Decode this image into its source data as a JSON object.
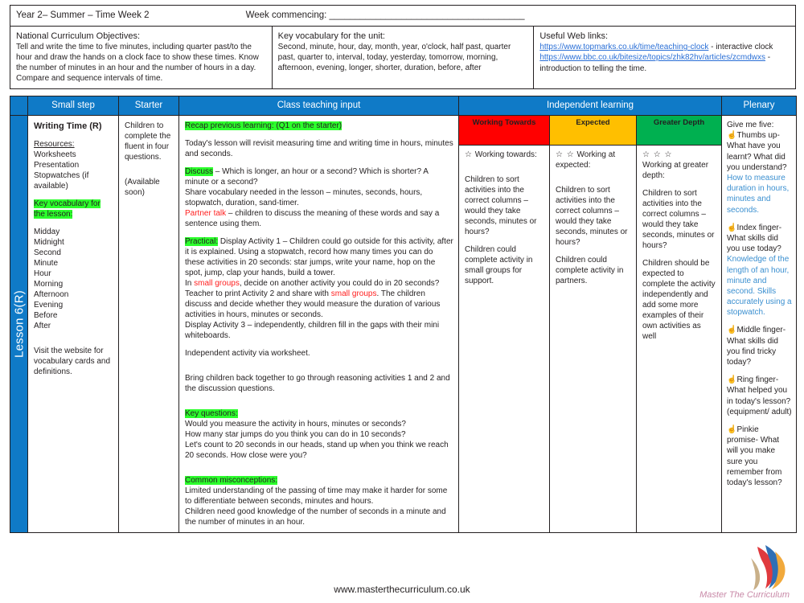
{
  "header": {
    "doc_title": "Year 2– Summer – Time Week 2",
    "week_commencing": "Week commencing: ______________________________________"
  },
  "info": {
    "nc_heading": "National Curriculum Objectives:",
    "nc_body": "Tell and write the time to five minutes, including quarter past/to the hour and draw the hands on a clock face to show these times. Know the number of minutes in an hour and the number of hours in a day. Compare and sequence intervals of time.",
    "vocab_heading": "Key vocabulary for the unit:",
    "vocab_body": "Second, minute, hour, day, month, year, o'clock, half past, quarter past, quarter to, interval, today, yesterday, tomorrow, morning, afternoon, evening, longer, shorter, duration, before, after",
    "weblinks_heading": "Useful Web links:",
    "weblinks": [
      {
        "url": "https://www.topmarks.co.uk/time/teaching-clock",
        "desc": " - interactive clock"
      },
      {
        "url": "https://www.bbc.co.uk/bitesize/topics/zhk82hv/articles/zcmdwxs",
        "desc": " - introduction to telling the time."
      }
    ]
  },
  "columns": {
    "small_step": "Small step",
    "starter": "Starter",
    "class_teaching_input": "Class teaching input",
    "independent_learning": "Independent learning",
    "plenary": "Plenary"
  },
  "spine_label": "Lesson 6(R)",
  "small_step": {
    "title": "Writing Time (R)",
    "resources_heading": "Resources:",
    "resources": "Worksheets\nPresentation\nStopwatches (if available)",
    "vocab_heading": "Key vocabulary for the lesson:",
    "vocab_words": "Midday\nMidnight\nSecond\nMinute\nHour\nMorning\nAfternoon\nEvening\nBefore\nAfter",
    "footnote": "Visit the website for vocabulary cards and definitions."
  },
  "starter": {
    "text": "Children to complete the fluent in four questions.",
    "availability": "(Available soon)"
  },
  "teaching": {
    "recap_heading": "Recap previous learning: (Q1 on the starter)",
    "recap_body": "Today's lesson will revisit measuring time and writing time in hours, minutes and seconds.",
    "discuss_heading": "Discuss",
    "discuss_body": " – Which is longer, an hour or a second? Which is shorter? A minute or a second?",
    "vocab_share": "Share vocabulary needed in the lesson – minutes, seconds, hours, stopwatch, duration, sand-timer.",
    "partner_talk_label": "Partner talk",
    "partner_talk_body": " – children to discuss the meaning of these words and say a sentence using them.",
    "practical_heading": "Practical:",
    "practical_body": " Display Activity 1 – Children could go outside for this activity, after it is explained. Using a stopwatch, record how many times you can do these activities in 20 seconds: star jumps, write your name, hop on the spot, jump, clap your hands, build a tower.",
    "small_groups_line_pre": "In ",
    "small_groups_label": "small groups",
    "small_groups_line_post": ", decide on another activity you could do in 20 seconds?",
    "activity2_pre": "Teacher to print Activity 2 and share with ",
    "activity2_label": "small groups",
    "activity2_post": ". The children discuss and decide whether they would measure the duration of various activities in hours, minutes or seconds.",
    "activity3": "Display Activity 3 – independently, children fill in the gaps with their mini whiteboards.",
    "independent_activity": "Independent activity via worksheet.",
    "bring_back": "Bring children back together to go through reasoning activities 1 and 2 and the discussion questions.",
    "key_questions_heading": "Key questions:",
    "key_questions": "Would you measure the activity in hours, minutes or seconds?\nHow many star jumps do you think you can do in 10 seconds?\nLet's count to 20 seconds in our heads, stand up when you think we reach 20 seconds. How close were you?",
    "misconceptions_heading": "Common misconceptions:",
    "misconceptions": "Limited understanding of the passing of time may make it harder for some to differentiate between seconds, minutes and hours.\nChildren need good knowledge of the number of seconds in a minute and the number of minutes in an hour."
  },
  "independent": [
    {
      "band": "Working Towards",
      "band_color": "#FF0000",
      "stars": "☆",
      "sub_heading": "Working towards:",
      "body1": "Children to sort activities into the correct columns – would they take seconds, minutes or hours?",
      "body2": "Children could complete activity in small groups for support."
    },
    {
      "band": "Expected",
      "band_color": "#FFBF00",
      "stars": "☆ ☆",
      "sub_heading": "Working at expected:",
      "body1": "Children to sort activities into the correct columns – would they take seconds, minutes or hours?",
      "body2": "Children could complete activity in partners."
    },
    {
      "band": "Greater Depth",
      "band_color": "#00B050",
      "stars": "☆ ☆ ☆",
      "sub_heading": "Working at greater depth:",
      "body1": "Children to sort activities into the correct columns – would they take seconds, minutes or hours?",
      "body2": "Children should be expected to complete the activity independently and add some more examples of their own activities as well"
    }
  ],
  "plenary": {
    "intro": "Give me five:",
    "items": [
      {
        "icon": "hand-icon",
        "question": "Thumbs up- What have you learnt? What did you understand?",
        "answer": "How to measure duration in hours, minutes and seconds."
      },
      {
        "icon": "hand-icon",
        "question": "Index finger- What skills did you use today?",
        "answer": "Knowledge of the length of an hour, minute and second. Skills accurately using a stopwatch."
      },
      {
        "icon": "hand-icon",
        "question": "Middle finger- What skills did you find tricky today?",
        "answer": ""
      },
      {
        "icon": "hand-icon",
        "question": "Ring finger- What helped you in today's lesson? (equipment/ adult)",
        "answer": ""
      },
      {
        "icon": "hand-icon",
        "question": "Pinkie promise- What will you make sure you remember from today's lesson?",
        "answer": ""
      }
    ]
  },
  "footer": {
    "website": "www.masterthecurriculum.co.uk",
    "logo_text": "Master The Curriculum"
  }
}
